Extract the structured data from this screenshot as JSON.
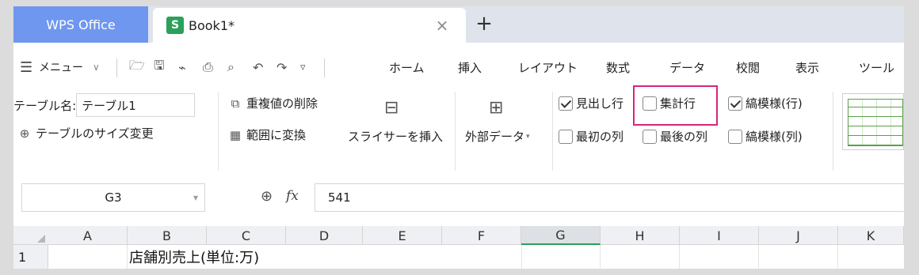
{
  "tabs": {
    "app_label": "WPS Office",
    "sheet_icon_letter": "S",
    "book_label": "Book1*",
    "close_glyph": "×",
    "add_glyph": "+"
  },
  "menu": {
    "menu_label": "メニュー",
    "items": [
      "ホーム",
      "挿入",
      "レイアウト",
      "数式",
      "データ",
      "校閲",
      "表示",
      "ツール"
    ]
  },
  "ribbon": {
    "table_name_label": "テーブル名:",
    "table_name_value": "テーブル1",
    "resize_label": "テーブルのサイズ変更",
    "remove_dup_label": "重複値の削除",
    "convert_label": "範囲に変換",
    "slicer_label": "スライサーを挿入",
    "external_label": "外部データ",
    "checkboxes": {
      "header_row": {
        "label": "見出し行",
        "checked": true
      },
      "total_row": {
        "label": "集計行",
        "checked": false
      },
      "banded_rows": {
        "label": "縞模様(行)",
        "checked": true
      },
      "first_column": {
        "label": "最初の列",
        "checked": false
      },
      "last_column": {
        "label": "最後の列",
        "checked": false
      },
      "banded_columns": {
        "label": "縞模様(列)",
        "checked": false
      }
    }
  },
  "formula_bar": {
    "name_box": "G3",
    "fx_label": "fx",
    "value": "541"
  },
  "grid": {
    "columns": [
      "A",
      "B",
      "C",
      "D",
      "E",
      "F",
      "G",
      "H",
      "I",
      "J",
      "K"
    ],
    "selected_column": "G",
    "row_number": "1",
    "b1_value": "店舗別売上(単位:万)"
  },
  "colors": {
    "accent_green": "#2aa05a",
    "wps_tab_blue": "#6f97f0",
    "highlight_pink": "#d6247e"
  }
}
